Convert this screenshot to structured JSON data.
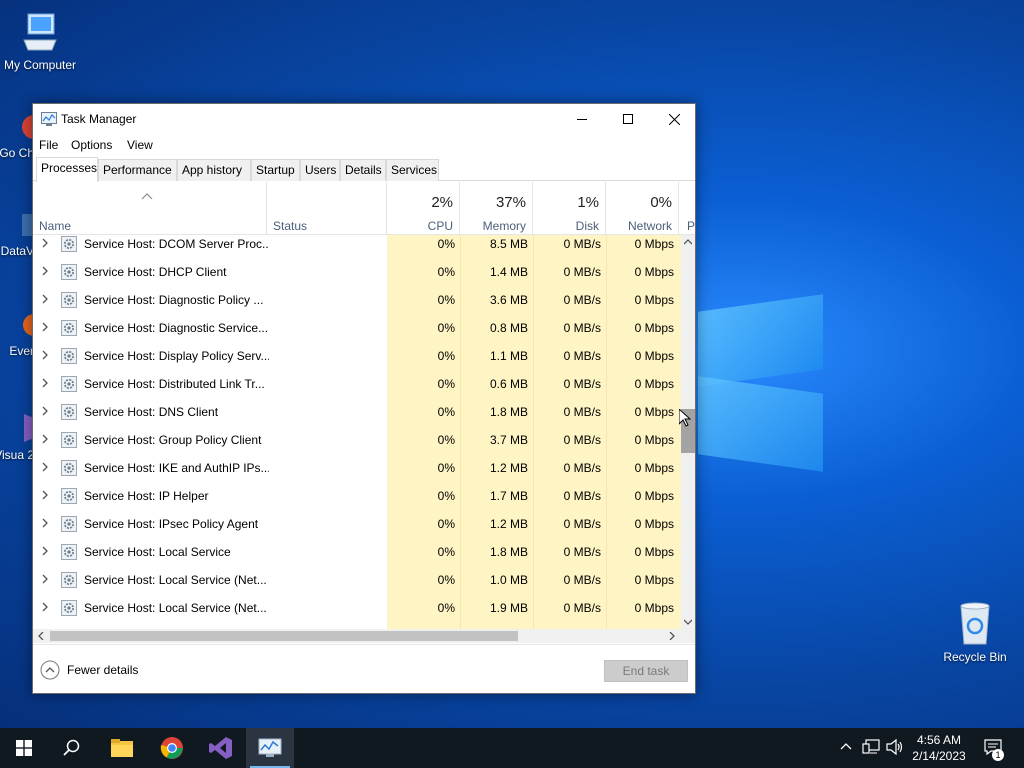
{
  "desktop": {
    "icons": [
      {
        "label": "My Computer"
      },
      {
        "label": "Go Ch"
      },
      {
        "label": "DataV"
      },
      {
        "label": "Ever"
      },
      {
        "label": "Visua 2"
      },
      {
        "label": "Recycle Bin"
      }
    ]
  },
  "window": {
    "title": "Task Manager",
    "menu": [
      "File",
      "Options",
      "View"
    ],
    "tabs": [
      "Processes",
      "Performance",
      "App history",
      "Startup",
      "Users",
      "Details",
      "Services"
    ],
    "active_tab": "Processes"
  },
  "columns": {
    "name": "Name",
    "status": "Status",
    "cpu": {
      "pct": "2%",
      "label": "CPU"
    },
    "memory": {
      "pct": "37%",
      "label": "Memory"
    },
    "disk": {
      "pct": "1%",
      "label": "Disk"
    },
    "network": {
      "pct": "0%",
      "label": "Network"
    },
    "power": "P"
  },
  "processes": [
    {
      "name": "Service Host: DCOM Server Proc...",
      "cpu": "0%",
      "memory": "8.5 MB",
      "disk": "0 MB/s",
      "network": "0 Mbps"
    },
    {
      "name": "Service Host: DHCP Client",
      "cpu": "0%",
      "memory": "1.4 MB",
      "disk": "0 MB/s",
      "network": "0 Mbps"
    },
    {
      "name": "Service Host: Diagnostic Policy ...",
      "cpu": "0%",
      "memory": "3.6 MB",
      "disk": "0 MB/s",
      "network": "0 Mbps"
    },
    {
      "name": "Service Host: Diagnostic Service...",
      "cpu": "0%",
      "memory": "0.8 MB",
      "disk": "0 MB/s",
      "network": "0 Mbps"
    },
    {
      "name": "Service Host: Display Policy Serv...",
      "cpu": "0%",
      "memory": "1.1 MB",
      "disk": "0 MB/s",
      "network": "0 Mbps"
    },
    {
      "name": "Service Host: Distributed Link Tr...",
      "cpu": "0%",
      "memory": "0.6 MB",
      "disk": "0 MB/s",
      "network": "0 Mbps"
    },
    {
      "name": "Service Host: DNS Client",
      "cpu": "0%",
      "memory": "1.8 MB",
      "disk": "0 MB/s",
      "network": "0 Mbps"
    },
    {
      "name": "Service Host: Group Policy Client",
      "cpu": "0%",
      "memory": "3.7 MB",
      "disk": "0 MB/s",
      "network": "0 Mbps"
    },
    {
      "name": "Service Host: IKE and AuthIP IPs...",
      "cpu": "0%",
      "memory": "1.2 MB",
      "disk": "0 MB/s",
      "network": "0 Mbps"
    },
    {
      "name": "Service Host: IP Helper",
      "cpu": "0%",
      "memory": "1.7 MB",
      "disk": "0 MB/s",
      "network": "0 Mbps"
    },
    {
      "name": "Service Host: IPsec Policy Agent",
      "cpu": "0%",
      "memory": "1.2 MB",
      "disk": "0 MB/s",
      "network": "0 Mbps"
    },
    {
      "name": "Service Host: Local Service",
      "cpu": "0%",
      "memory": "1.8 MB",
      "disk": "0 MB/s",
      "network": "0 Mbps"
    },
    {
      "name": "Service Host: Local Service (Net...",
      "cpu": "0%",
      "memory": "1.0 MB",
      "disk": "0 MB/s",
      "network": "0 Mbps"
    },
    {
      "name": "Service Host: Local Service (Net...",
      "cpu": "0%",
      "memory": "1.9 MB",
      "disk": "0 MB/s",
      "network": "0 Mbps"
    }
  ],
  "footer": {
    "fewer_details": "Fewer details",
    "end_task": "End task"
  },
  "taskbar": {
    "time": "4:56 AM",
    "date": "2/14/2023",
    "notifications": "1",
    "apps": [
      "start-icon",
      "search-icon",
      "file-explorer-icon",
      "chrome-icon",
      "visual-studio-icon",
      "task-manager-icon"
    ]
  },
  "colors": {
    "usage_highlight": "#fff4c4",
    "taskbar": "#101820",
    "accent": "#76b9ed"
  }
}
